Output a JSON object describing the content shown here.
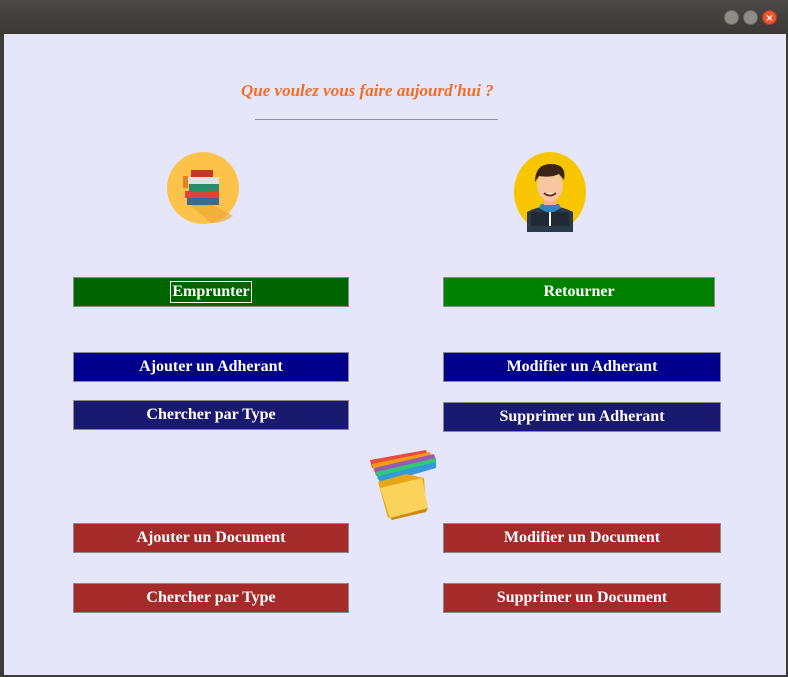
{
  "window": {
    "min_glyph": "",
    "max_glyph": "",
    "close_glyph": "×"
  },
  "heading": "Que voulez vous faire aujourd'hui ?",
  "icons": {
    "books": "books-icon",
    "reader": "person-reading-icon",
    "folder": "folder-icon"
  },
  "buttons": {
    "emprunter": "Emprunter",
    "retourner": "Retourner",
    "ajouter_adherant": "Ajouter un Adherant",
    "modifier_adherant": "Modifier un Adherant",
    "chercher_type_adherant": "Chercher par Type",
    "supprimer_adherant": "Supprimer un Adherant",
    "ajouter_document": "Ajouter un Document",
    "modifier_document": "Modifier un Document",
    "chercher_type_document": "Chercher par Type",
    "supprimer_document": "Supprimer un Document"
  },
  "colors": {
    "heading": "#f36c22",
    "background": "#e6e6fa",
    "emprunter": "#006400",
    "retourner": "#008000",
    "adherant_primary": "#00008b",
    "adherant_secondary": "#191970",
    "document": "#a52a2a"
  }
}
